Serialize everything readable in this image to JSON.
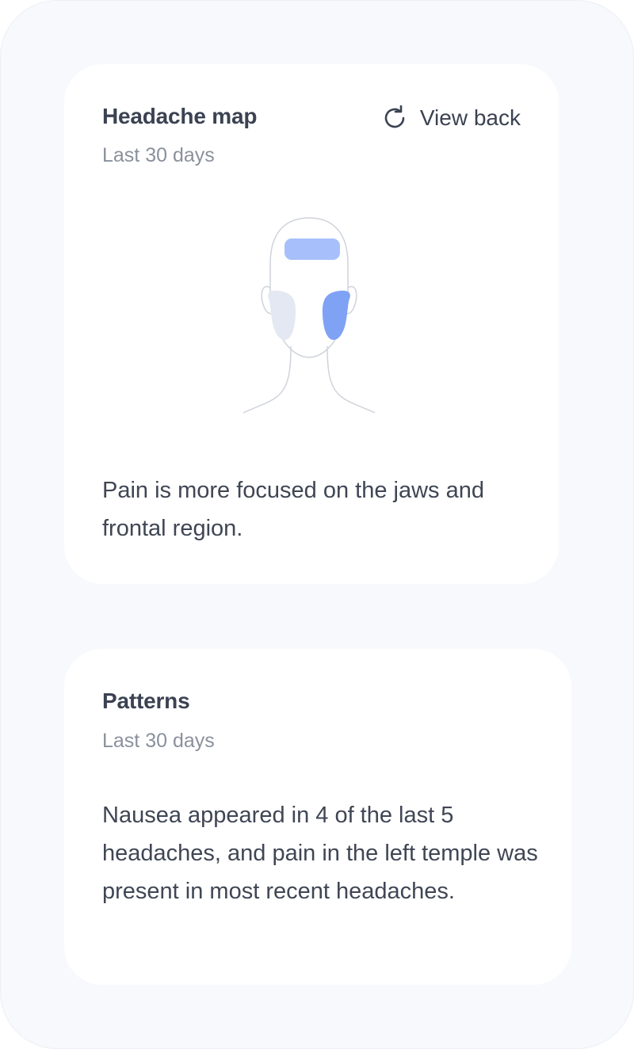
{
  "headache_map": {
    "title": "Headache map",
    "subtitle": "Last 30 days",
    "view_back_label": "View back",
    "view_back_icon": "rotate-cw-icon",
    "summary": "Pain is more focused on the jaws and frontal region.",
    "pain_regions": [
      {
        "name": "frontal",
        "color": "#a7c0fb"
      },
      {
        "name": "right-jaw",
        "color": "#e4e8f2"
      },
      {
        "name": "left-jaw",
        "color": "#7fa2f5"
      }
    ]
  },
  "patterns": {
    "title": "Patterns",
    "subtitle": "Last 30 days",
    "summary": "Nausea appeared in 4 of the last 5 headaches, and pain in the left temple was present in most recent headaches."
  }
}
